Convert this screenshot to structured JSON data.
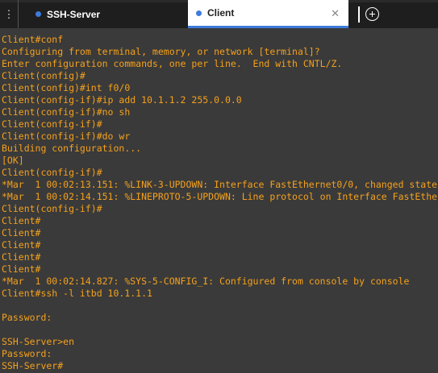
{
  "tabs": {
    "server_label": "SSH-Server",
    "client_label": "Client",
    "close_glyph": "✕",
    "accent": "#3d7bdc"
  },
  "terminal": {
    "text_color": "#f5a11c",
    "background": "#3a3a3a",
    "lines": [
      "Client#conf",
      "Configuring from terminal, memory, or network [terminal]?",
      "Enter configuration commands, one per line.  End with CNTL/Z.",
      "Client(config)#",
      "Client(config)#int f0/0",
      "Client(config-if)#ip add 10.1.1.2 255.0.0.0",
      "Client(config-if)#no sh",
      "Client(config-if)#",
      "Client(config-if)#do wr",
      "Building configuration...",
      "[OK]",
      "Client(config-if)#",
      "*Mar  1 00:02:13.151: %LINK-3-UPDOWN: Interface FastEthernet0/0, changed state",
      "*Mar  1 00:02:14.151: %LINEPROTO-5-UPDOWN: Line protocol on Interface FastEthe",
      "Client(config-if)#",
      "Client#",
      "Client#",
      "Client#",
      "Client#",
      "Client#",
      "*Mar  1 00:02:14.827: %SYS-5-CONFIG_I: Configured from console by console",
      "Client#ssh -l itbd 10.1.1.1",
      "",
      "Password:",
      "",
      "SSH-Server>en",
      "Password:",
      "SSH-Server#"
    ]
  }
}
